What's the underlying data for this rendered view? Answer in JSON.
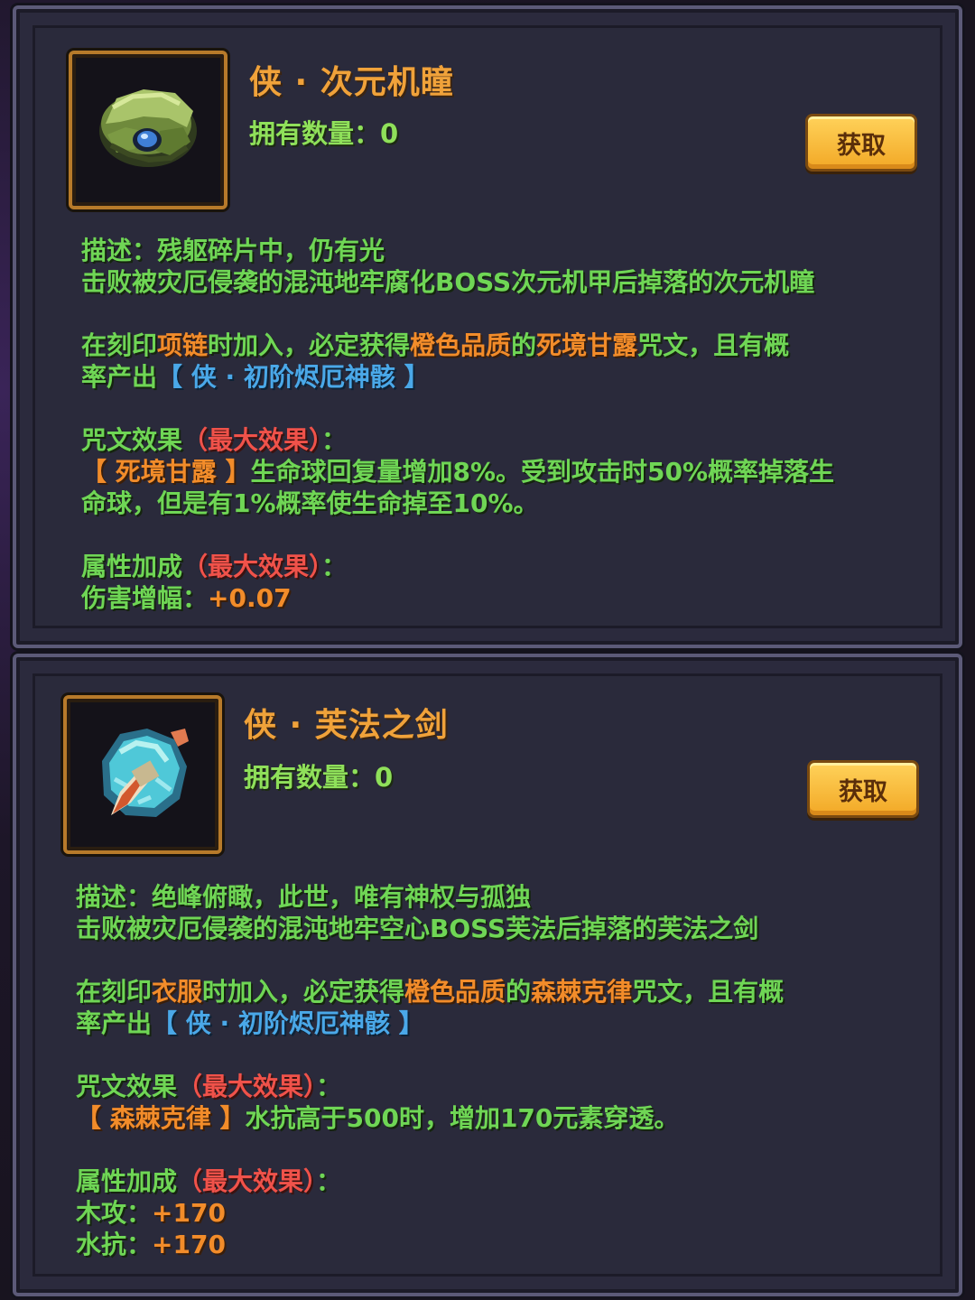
{
  "cards": [
    {
      "title": "侠 · 次元机瞳",
      "owned_label": "拥有数量：",
      "owned_count": "0",
      "button": "获取",
      "icon": "dimension-eye-gear-icon",
      "desc_label": "描述：",
      "desc_flavor": "残躯碎片中，仍有光",
      "desc_source": "击败被灾厄侵袭的混沌地牢腐化BOSS次元机甲后掉落的次元机瞳",
      "engrave_1": "在刻印",
      "engrave_slot": "项链",
      "engrave_2": "时加入，必定获得",
      "engrave_quality": "橙色品质",
      "engrave_3": "的",
      "engrave_rune": "死境甘露",
      "engrave_4": "咒文，且有概",
      "engrave_5": "率产出",
      "engrave_item": "【 侠 · 初阶烬厄神骸 】",
      "rune_effect_label": "咒文效果",
      "max_effect": "（最大效果）",
      "colon": "：",
      "rune_name": "【 死境甘露 】",
      "rune_effect_1": "生命球回复量增加8%。受到攻击时50%概率掉落生",
      "rune_effect_2": "命球，但是有1%概率使生命掉至10%。",
      "attr_label": "属性加成",
      "attrs": [
        {
          "name": "伤害增幅：",
          "value": "+0.07"
        }
      ]
    },
    {
      "title": "侠 · 芙法之剑",
      "owned_label": "拥有数量：",
      "owned_count": "0",
      "button": "获取",
      "icon": "sword-crystal-icon",
      "desc_label": "描述：",
      "desc_flavor": "绝峰俯瞰，此世，唯有神权与孤独",
      "desc_source": "击败被灾厄侵袭的混沌地牢空心BOSS芙法后掉落的芙法之剑",
      "engrave_1": "在刻印",
      "engrave_slot": "衣服",
      "engrave_2": "时加入，必定获得",
      "engrave_quality": "橙色品质",
      "engrave_3": "的",
      "engrave_rune": "森棘克律",
      "engrave_4": "咒文，且有概",
      "engrave_5": "率产出",
      "engrave_item": "【 侠 · 初阶烬厄神骸 】",
      "rune_effect_label": "咒文效果",
      "max_effect": "（最大效果）",
      "colon": "：",
      "rune_name": "【 森棘克律 】",
      "rune_effect_1": "水抗高于500时，增加170元素穿透。",
      "rune_effect_2": "",
      "attr_label": "属性加成",
      "attrs": [
        {
          "name": "木攻：",
          "value": "+170"
        },
        {
          "name": "水抗：",
          "value": "+170"
        }
      ]
    }
  ]
}
